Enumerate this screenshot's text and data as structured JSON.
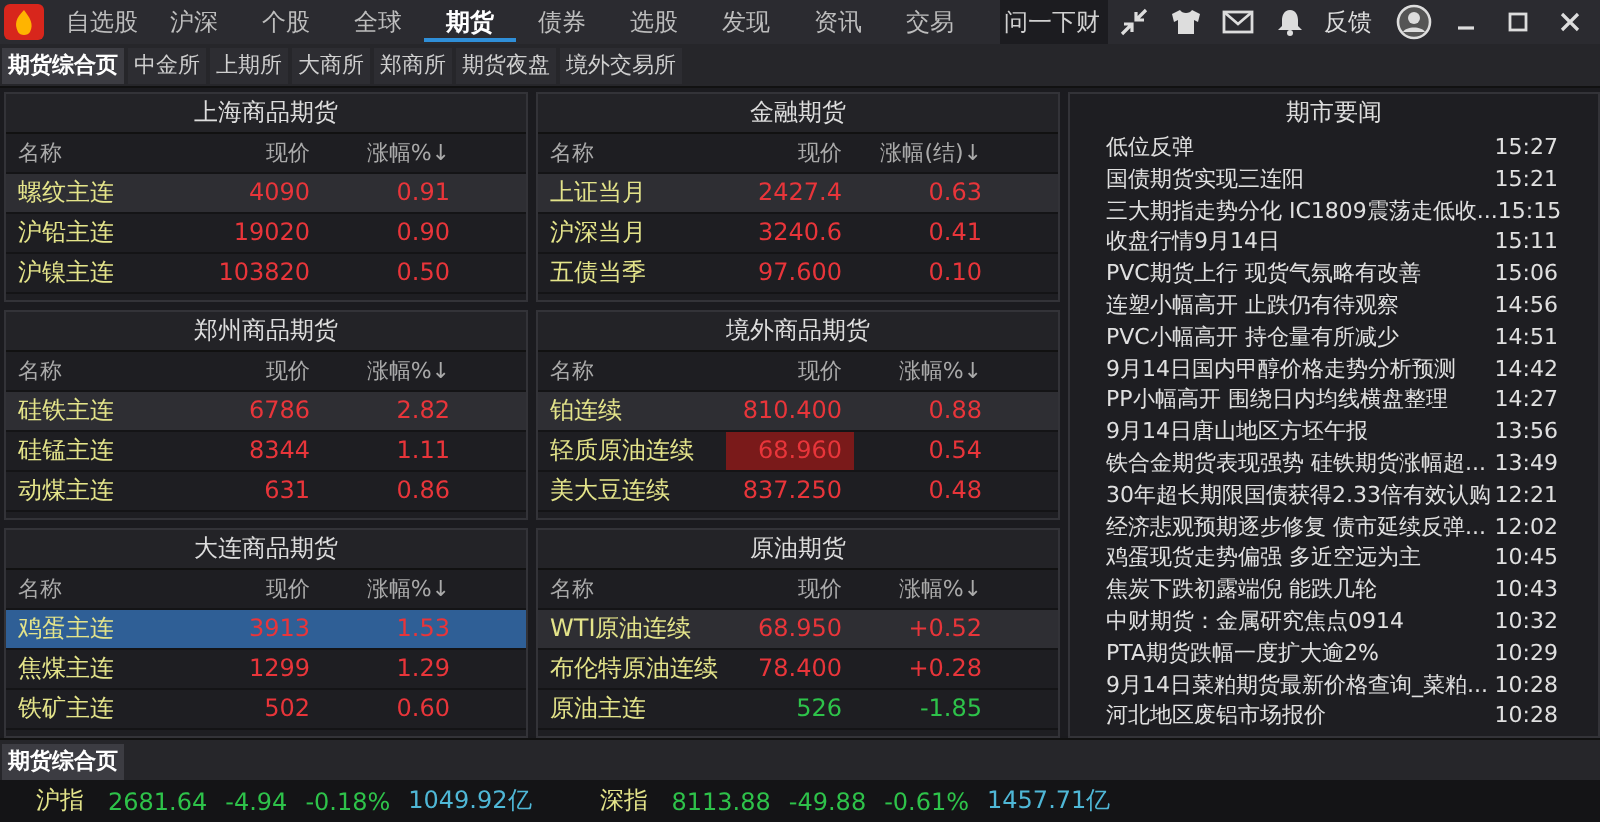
{
  "nav": {
    "items": [
      {
        "label": "自选股",
        "selected": false
      },
      {
        "label": "沪深",
        "selected": false
      },
      {
        "label": "个股",
        "selected": false
      },
      {
        "label": "全球",
        "selected": false
      },
      {
        "label": "期货",
        "selected": true
      },
      {
        "label": "债券",
        "selected": false
      },
      {
        "label": "选股",
        "selected": false
      },
      {
        "label": "发现",
        "selected": false
      },
      {
        "label": "资讯",
        "selected": false
      },
      {
        "label": "交易",
        "selected": false
      }
    ],
    "search": {
      "placeholder": "问一下财"
    },
    "feedback": "反馈"
  },
  "subtabs": [
    {
      "label": "期货综合页",
      "selected": true
    },
    {
      "label": "中金所",
      "selected": false
    },
    {
      "label": "上期所",
      "selected": false
    },
    {
      "label": "大商所",
      "selected": false
    },
    {
      "label": "郑商所",
      "selected": false
    },
    {
      "label": "期货夜盘",
      "selected": false
    },
    {
      "label": "境外交易所",
      "selected": false
    }
  ],
  "panels": [
    {
      "title": "上海商品期货",
      "columns": [
        "名称",
        "现价",
        "涨幅%↓"
      ],
      "rows": [
        {
          "name": "螺纹主连",
          "price": "4090",
          "change": "0.91",
          "kind": "up",
          "highlighted": true,
          "selected": false,
          "flash": false
        },
        {
          "name": "沪铅主连",
          "price": "19020",
          "change": "0.90",
          "kind": "up",
          "highlighted": false,
          "selected": false,
          "flash": false
        },
        {
          "name": "沪镍主连",
          "price": "103820",
          "change": "0.50",
          "kind": "up",
          "highlighted": false,
          "selected": false,
          "flash": false
        }
      ]
    },
    {
      "title": "金融期货",
      "columns": [
        "名称",
        "现价",
        "涨幅(结)↓"
      ],
      "rows": [
        {
          "name": "上证当月",
          "price": "2427.4",
          "change": "0.63",
          "kind": "up",
          "highlighted": true,
          "selected": false,
          "flash": false
        },
        {
          "name": "沪深当月",
          "price": "3240.6",
          "change": "0.41",
          "kind": "up",
          "highlighted": false,
          "selected": false,
          "flash": false
        },
        {
          "name": "五债当季",
          "price": "97.600",
          "change": "0.10",
          "kind": "up",
          "highlighted": false,
          "selected": false,
          "flash": false
        }
      ]
    },
    {
      "title": "郑州商品期货",
      "columns": [
        "名称",
        "现价",
        "涨幅%↓"
      ],
      "rows": [
        {
          "name": "硅铁主连",
          "price": "6786",
          "change": "2.82",
          "kind": "up",
          "highlighted": true,
          "selected": false,
          "flash": false
        },
        {
          "name": "硅锰主连",
          "price": "8344",
          "change": "1.11",
          "kind": "up",
          "highlighted": false,
          "selected": false,
          "flash": false
        },
        {
          "name": "动煤主连",
          "price": "631",
          "change": "0.86",
          "kind": "up",
          "highlighted": false,
          "selected": false,
          "flash": false
        }
      ]
    },
    {
      "title": "境外商品期货",
      "columns": [
        "名称",
        "现价",
        "涨幅%↓"
      ],
      "rows": [
        {
          "name": "铂连续",
          "price": "810.400",
          "change": "0.88",
          "kind": "up",
          "highlighted": true,
          "selected": false,
          "flash": false
        },
        {
          "name": "轻质原油连续",
          "price": "68.960",
          "change": "0.54",
          "kind": "up",
          "highlighted": false,
          "selected": false,
          "flash": true
        },
        {
          "name": "美大豆连续",
          "price": "837.250",
          "change": "0.48",
          "kind": "up",
          "highlighted": false,
          "selected": false,
          "flash": false
        }
      ]
    },
    {
      "title": "大连商品期货",
      "columns": [
        "名称",
        "现价",
        "涨幅%↓"
      ],
      "rows": [
        {
          "name": "鸡蛋主连",
          "price": "3913",
          "change": "1.53",
          "kind": "up",
          "highlighted": false,
          "selected": true,
          "flash": false
        },
        {
          "name": "焦煤主连",
          "price": "1299",
          "change": "1.29",
          "kind": "up",
          "highlighted": false,
          "selected": false,
          "flash": false
        },
        {
          "name": "铁矿主连",
          "price": "502",
          "change": "0.60",
          "kind": "up",
          "highlighted": false,
          "selected": false,
          "flash": false
        }
      ]
    },
    {
      "title": "原油期货",
      "columns": [
        "名称",
        "现价",
        "涨幅%↓"
      ],
      "rows": [
        {
          "name": "WTI原油连续",
          "price": "68.950",
          "change": "+0.52",
          "kind": "up",
          "highlighted": true,
          "selected": false,
          "flash": false
        },
        {
          "name": "布伦特原油连续",
          "price": "78.400",
          "change": "+0.28",
          "kind": "up",
          "highlighted": false,
          "selected": false,
          "flash": false
        },
        {
          "name": "原油主连",
          "price": "526",
          "change": "-1.85",
          "kind": "down",
          "highlighted": false,
          "selected": false,
          "flash": false
        }
      ]
    }
  ],
  "news": {
    "title": "期市要闻",
    "items": [
      {
        "headline": "低位反弹",
        "time": "15:27"
      },
      {
        "headline": "国债期货实现三连阳",
        "time": "15:21"
      },
      {
        "headline": "三大期指走势分化 IC1809震荡走低收...",
        "time": "15:15"
      },
      {
        "headline": "收盘行情9月14日",
        "time": "15:11"
      },
      {
        "headline": "PVC期货上行 现货气氛略有改善",
        "time": "15:06"
      },
      {
        "headline": "连塑小幅高开 止跌仍有待观察",
        "time": "14:56"
      },
      {
        "headline": "PVC小幅高开 持仓量有所减少",
        "time": "14:51"
      },
      {
        "headline": "9月14日国内甲醇价格走势分析预测",
        "time": "14:42"
      },
      {
        "headline": "PP小幅高开 围绕日内均线横盘整理",
        "time": "14:27"
      },
      {
        "headline": "9月14日唐山地区方坯午报",
        "time": "13:56"
      },
      {
        "headline": "铁合金期货表现强势 硅铁期货涨幅超...",
        "time": "13:49"
      },
      {
        "headline": "30年超长期限国债获得2.33倍有效认购",
        "time": "12:21"
      },
      {
        "headline": "经济悲观预期逐步修复 债市延续反弹...",
        "time": "12:02"
      },
      {
        "headline": "鸡蛋现货走势偏强 多近空远为主",
        "time": "10:45"
      },
      {
        "headline": "焦炭下跌初露端倪 能跌几轮",
        "time": "10:43"
      },
      {
        "headline": "中财期货：金属研究焦点0914",
        "time": "10:32"
      },
      {
        "headline": "PTA期货跌幅一度扩大逾2%",
        "time": "10:29"
      },
      {
        "headline": "9月14日菜粕期货最新价格查询_菜粕...",
        "time": "10:28"
      },
      {
        "headline": "河北地区废铝市场报价",
        "time": "10:28"
      }
    ]
  },
  "bottom_tabs": [
    {
      "label": "期货综合页",
      "selected": true
    }
  ],
  "status": [
    {
      "name": "沪指",
      "values": [
        "2681.64",
        "-4.94",
        "-0.18%"
      ],
      "volume": "1049.92亿",
      "kind": "down"
    },
    {
      "name": "深指",
      "values": [
        "8113.88",
        "-49.88",
        "-0.61%"
      ],
      "volume": "1457.71亿",
      "kind": "down"
    }
  ]
}
